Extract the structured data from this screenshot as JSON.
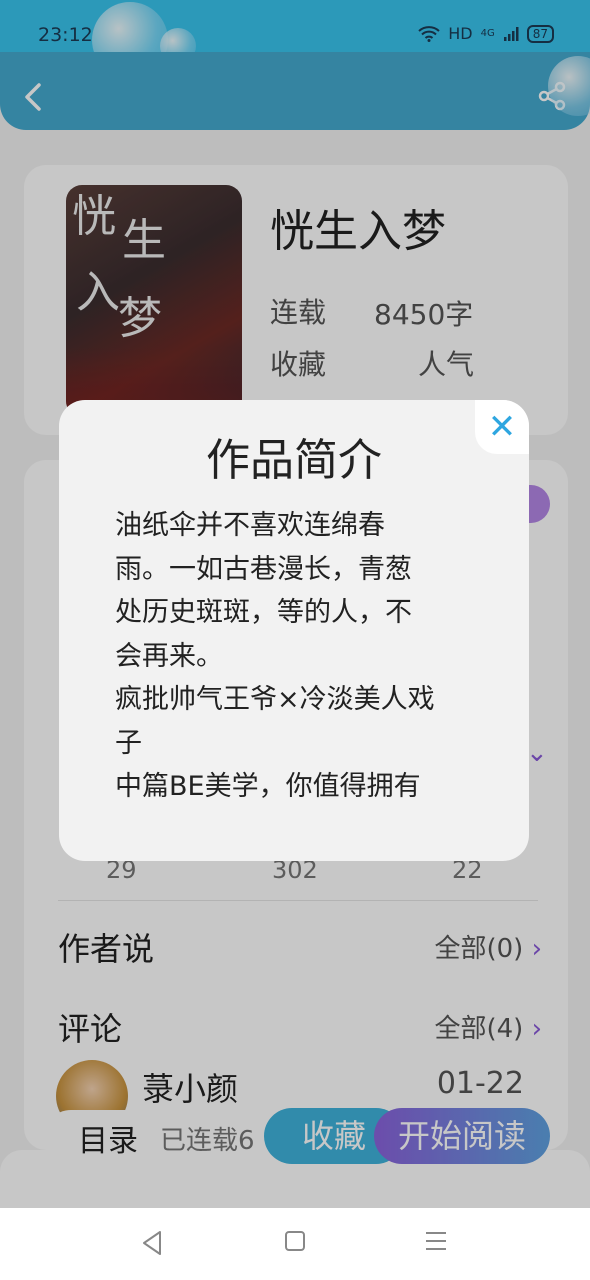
{
  "status": {
    "time": "23:12",
    "network": "HD",
    "signal": "4G",
    "battery": "87"
  },
  "header": {
    "back_icon": "chevron-left-icon",
    "share_icon": "share-icon"
  },
  "book": {
    "title": "恍生入梦",
    "status": "连载",
    "word_count": "8450字",
    "favorites_label": "收藏",
    "popularity_label": "人气",
    "cover_text": [
      "恍",
      "生",
      "入",
      "梦"
    ]
  },
  "stats": {
    "values": [
      "29",
      "302",
      "22"
    ]
  },
  "sections": {
    "author_says": {
      "label": "作者说",
      "all": "全部(0)"
    },
    "comments": {
      "label": "评论",
      "all": "全部(4)"
    }
  },
  "comment": {
    "author": "菉小颜",
    "date": "01-22"
  },
  "bottom": {
    "toc": "目录",
    "toc_status": "已连载6",
    "favorite": "收藏",
    "start_reading": "开始阅读"
  },
  "modal": {
    "title": "作品简介",
    "close_icon": "close-icon",
    "paragraphs": [
      "油纸伞并不喜欢连绵春\n雨。一如古巷漫长，青葱\n处历史斑斑，等的人，不\n会再来。",
      "疯批帅气王爷×冷淡美人戏\n子",
      "中篇BE美学，你值得拥有"
    ]
  },
  "navbar": {
    "back": "triangle-back-icon",
    "home": "square-home-icon",
    "menu": "menu-lines-icon"
  }
}
